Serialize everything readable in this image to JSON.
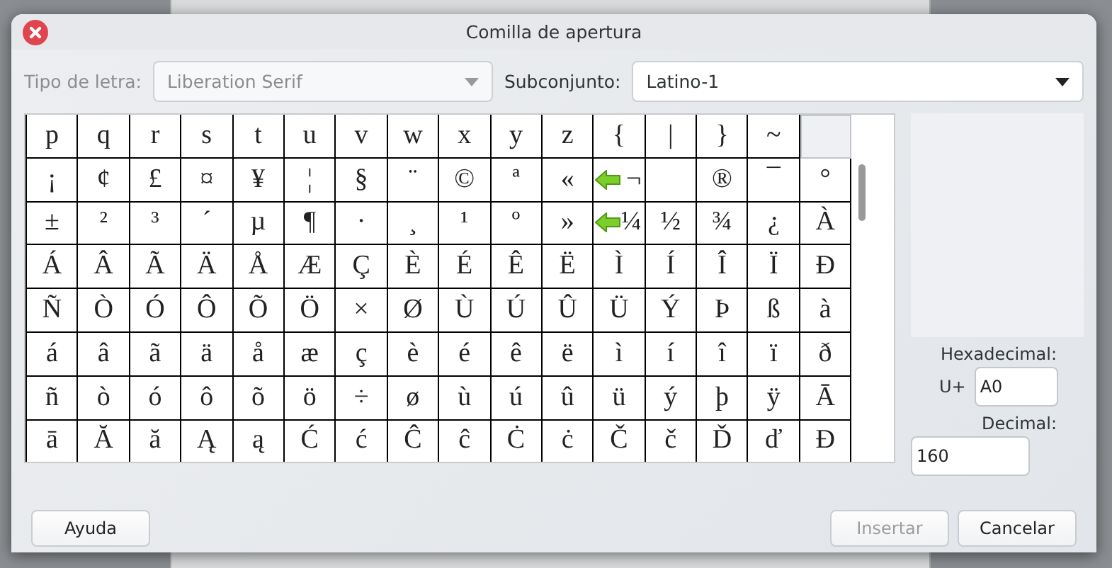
{
  "window": {
    "title": "Comilla de apertura"
  },
  "font": {
    "label": "Tipo de letra:",
    "value": "Liberation Serif",
    "disabled": true
  },
  "subset": {
    "label": "Subconjunto:",
    "value": "Latino-1"
  },
  "grid": [
    [
      {
        "char": "p",
        "selected": false,
        "arrow": false
      },
      {
        "char": "q",
        "selected": false,
        "arrow": false
      },
      {
        "char": "r",
        "selected": false,
        "arrow": false
      },
      {
        "char": "s",
        "selected": false,
        "arrow": false
      },
      {
        "char": "t",
        "selected": false,
        "arrow": false
      },
      {
        "char": "u",
        "selected": false,
        "arrow": false
      },
      {
        "char": "v",
        "selected": false,
        "arrow": false
      },
      {
        "char": "w",
        "selected": false,
        "arrow": false
      },
      {
        "char": "x",
        "selected": false,
        "arrow": false
      },
      {
        "char": "y",
        "selected": false,
        "arrow": false
      },
      {
        "char": "z",
        "selected": false,
        "arrow": false
      },
      {
        "char": "{",
        "selected": false,
        "arrow": false
      },
      {
        "char": "|",
        "selected": false,
        "arrow": false
      },
      {
        "char": "}",
        "selected": false,
        "arrow": false
      },
      {
        "char": "~",
        "selected": false,
        "arrow": false
      },
      {
        "selected": true,
        "arrow": false
      }
    ],
    [
      {
        "char": "¡",
        "selected": false,
        "arrow": false
      },
      {
        "char": "¢",
        "selected": false,
        "arrow": false
      },
      {
        "char": "£",
        "selected": false,
        "arrow": false
      },
      {
        "char": "¤",
        "selected": false,
        "arrow": false
      },
      {
        "char": "¥",
        "selected": false,
        "arrow": false
      },
      {
        "char": "¦",
        "selected": false,
        "arrow": false
      },
      {
        "char": "§",
        "selected": false,
        "arrow": false
      },
      {
        "char": "¨",
        "selected": false,
        "arrow": false
      },
      {
        "char": "©",
        "selected": false,
        "arrow": false
      },
      {
        "char": "ª",
        "selected": false,
        "arrow": false
      },
      {
        "char": "«",
        "selected": false,
        "arrow": false
      },
      {
        "char": "¬",
        "selected": false,
        "arrow": true
      },
      {
        "selected": false,
        "arrow": false
      },
      {
        "char": "®",
        "selected": false,
        "arrow": false
      },
      {
        "char": "¯",
        "selected": false,
        "arrow": false
      },
      {
        "char": "°",
        "selected": false,
        "arrow": false
      }
    ],
    [
      {
        "char": "±",
        "selected": false,
        "arrow": false
      },
      {
        "char": "²",
        "selected": false,
        "arrow": false
      },
      {
        "char": "³",
        "selected": false,
        "arrow": false
      },
      {
        "char": "´",
        "selected": false,
        "arrow": false
      },
      {
        "char": "µ",
        "selected": false,
        "arrow": false
      },
      {
        "char": "¶",
        "selected": false,
        "arrow": false
      },
      {
        "char": "·",
        "selected": false,
        "arrow": false
      },
      {
        "char": "¸",
        "selected": false,
        "arrow": false
      },
      {
        "char": "¹",
        "selected": false,
        "arrow": false
      },
      {
        "char": "º",
        "selected": false,
        "arrow": false
      },
      {
        "char": "»",
        "selected": false,
        "arrow": false
      },
      {
        "char": "¼",
        "selected": false,
        "arrow": true
      },
      {
        "char": "½",
        "selected": false,
        "arrow": false
      },
      {
        "char": "¾",
        "selected": false,
        "arrow": false
      },
      {
        "char": "¿",
        "selected": false,
        "arrow": false
      },
      {
        "char": "À",
        "selected": false,
        "arrow": false
      }
    ],
    [
      {
        "char": "Á",
        "selected": false,
        "arrow": false
      },
      {
        "char": "Â",
        "selected": false,
        "arrow": false
      },
      {
        "char": "Ã",
        "selected": false,
        "arrow": false
      },
      {
        "char": "Ä",
        "selected": false,
        "arrow": false
      },
      {
        "char": "Å",
        "selected": false,
        "arrow": false
      },
      {
        "char": "Æ",
        "selected": false,
        "arrow": false
      },
      {
        "char": "Ç",
        "selected": false,
        "arrow": false
      },
      {
        "char": "È",
        "selected": false,
        "arrow": false
      },
      {
        "char": "É",
        "selected": false,
        "arrow": false
      },
      {
        "char": "Ê",
        "selected": false,
        "arrow": false
      },
      {
        "char": "Ë",
        "selected": false,
        "arrow": false
      },
      {
        "char": "Ì",
        "selected": false,
        "arrow": false
      },
      {
        "char": "Í",
        "selected": false,
        "arrow": false
      },
      {
        "char": "Î",
        "selected": false,
        "arrow": false
      },
      {
        "char": "Ï",
        "selected": false,
        "arrow": false
      },
      {
        "char": "Ð",
        "selected": false,
        "arrow": false
      }
    ],
    [
      {
        "char": "Ñ",
        "selected": false,
        "arrow": false
      },
      {
        "char": "Ò",
        "selected": false,
        "arrow": false
      },
      {
        "char": "Ó",
        "selected": false,
        "arrow": false
      },
      {
        "char": "Ô",
        "selected": false,
        "arrow": false
      },
      {
        "char": "Õ",
        "selected": false,
        "arrow": false
      },
      {
        "char": "Ö",
        "selected": false,
        "arrow": false
      },
      {
        "char": "×",
        "selected": false,
        "arrow": false
      },
      {
        "char": "Ø",
        "selected": false,
        "arrow": false
      },
      {
        "char": "Ù",
        "selected": false,
        "arrow": false
      },
      {
        "char": "Ú",
        "selected": false,
        "arrow": false
      },
      {
        "char": "Û",
        "selected": false,
        "arrow": false
      },
      {
        "char": "Ü",
        "selected": false,
        "arrow": false
      },
      {
        "char": "Ý",
        "selected": false,
        "arrow": false
      },
      {
        "char": "Þ",
        "selected": false,
        "arrow": false
      },
      {
        "char": "ß",
        "selected": false,
        "arrow": false
      },
      {
        "char": "à",
        "selected": false,
        "arrow": false
      }
    ],
    [
      {
        "char": "á",
        "selected": false,
        "arrow": false
      },
      {
        "char": "â",
        "selected": false,
        "arrow": false
      },
      {
        "char": "ã",
        "selected": false,
        "arrow": false
      },
      {
        "char": "ä",
        "selected": false,
        "arrow": false
      },
      {
        "char": "å",
        "selected": false,
        "arrow": false
      },
      {
        "char": "æ",
        "selected": false,
        "arrow": false
      },
      {
        "char": "ç",
        "selected": false,
        "arrow": false
      },
      {
        "char": "è",
        "selected": false,
        "arrow": false
      },
      {
        "char": "é",
        "selected": false,
        "arrow": false
      },
      {
        "char": "ê",
        "selected": false,
        "arrow": false
      },
      {
        "char": "ë",
        "selected": false,
        "arrow": false
      },
      {
        "char": "ì",
        "selected": false,
        "arrow": false
      },
      {
        "char": "í",
        "selected": false,
        "arrow": false
      },
      {
        "char": "î",
        "selected": false,
        "arrow": false
      },
      {
        "char": "ï",
        "selected": false,
        "arrow": false
      },
      {
        "char": "ð",
        "selected": false,
        "arrow": false
      }
    ],
    [
      {
        "char": "ñ",
        "selected": false,
        "arrow": false
      },
      {
        "char": "ò",
        "selected": false,
        "arrow": false
      },
      {
        "char": "ó",
        "selected": false,
        "arrow": false
      },
      {
        "char": "ô",
        "selected": false,
        "arrow": false
      },
      {
        "char": "õ",
        "selected": false,
        "arrow": false
      },
      {
        "char": "ö",
        "selected": false,
        "arrow": false
      },
      {
        "char": "÷",
        "selected": false,
        "arrow": false
      },
      {
        "char": "ø",
        "selected": false,
        "arrow": false
      },
      {
        "char": "ù",
        "selected": false,
        "arrow": false
      },
      {
        "char": "ú",
        "selected": false,
        "arrow": false
      },
      {
        "char": "û",
        "selected": false,
        "arrow": false
      },
      {
        "char": "ü",
        "selected": false,
        "arrow": false
      },
      {
        "char": "ý",
        "selected": false,
        "arrow": false
      },
      {
        "char": "þ",
        "selected": false,
        "arrow": false
      },
      {
        "char": "ÿ",
        "selected": false,
        "arrow": false
      },
      {
        "char": "Ā",
        "selected": false,
        "arrow": false
      }
    ],
    [
      {
        "char": "ā",
        "selected": false,
        "arrow": false
      },
      {
        "char": "Ă",
        "selected": false,
        "arrow": false
      },
      {
        "char": "ă",
        "selected": false,
        "arrow": false
      },
      {
        "char": "Ą",
        "selected": false,
        "arrow": false
      },
      {
        "char": "ą",
        "selected": false,
        "arrow": false
      },
      {
        "char": "Ć",
        "selected": false,
        "arrow": false
      },
      {
        "char": "ć",
        "selected": false,
        "arrow": false
      },
      {
        "char": "Ĉ",
        "selected": false,
        "arrow": false
      },
      {
        "char": "ĉ",
        "selected": false,
        "arrow": false
      },
      {
        "char": "Ċ",
        "selected": false,
        "arrow": false
      },
      {
        "char": "ċ",
        "selected": false,
        "arrow": false
      },
      {
        "char": "Č",
        "selected": false,
        "arrow": false
      },
      {
        "char": "č",
        "selected": false,
        "arrow": false
      },
      {
        "char": "Ď",
        "selected": false,
        "arrow": false
      },
      {
        "char": "ď",
        "selected": false,
        "arrow": false
      },
      {
        "char": "Đ",
        "selected": false,
        "arrow": false
      }
    ]
  ],
  "hex": {
    "label": "Hexadecimal:",
    "prefix": "U+",
    "value": "A0"
  },
  "decimal": {
    "label": "Decimal:",
    "value": "160"
  },
  "buttons": [
    {
      "label": "Ayuda",
      "kind": "help"
    },
    {
      "label": "Insertar",
      "kind": "action",
      "disabled": true
    },
    {
      "label": "Cancelar",
      "kind": "action",
      "disabled": false
    }
  ]
}
